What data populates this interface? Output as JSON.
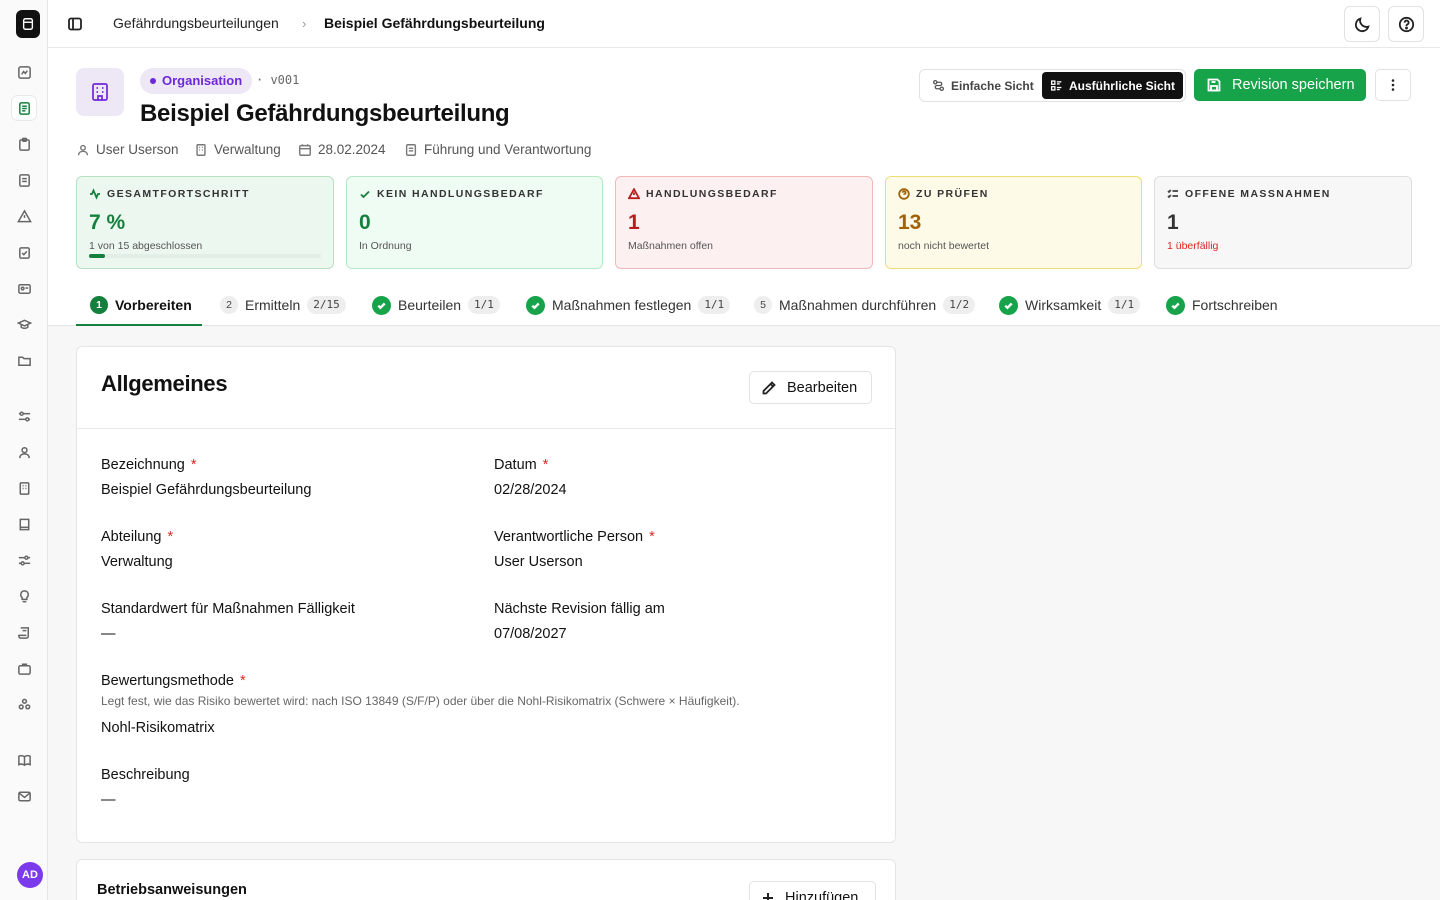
{
  "breadcrumb": {
    "parent": "Gefährdungsbeurteilungen",
    "current": "Beispiel Gefährdungsbeurteilung"
  },
  "sidebar": {
    "avatar_initials": "AD"
  },
  "header": {
    "badge": "Organisation",
    "version": "· v001",
    "title": "Beispiel Gefährdungsbeurteilung",
    "meta": {
      "user": "User Userson",
      "department": "Verwaltung",
      "date": "28.02.2024",
      "category": "Führung und Verantwortung"
    },
    "view_simple": "Einfache Sicht",
    "view_detail": "Ausführliche Sicht",
    "save_label": "Revision speichern"
  },
  "stats": [
    {
      "label": "GESAMTFORTSCHRITT",
      "value": "7 %",
      "sub": "1 von 15 abgeschlossen",
      "progress": 0.07,
      "color": "#15803d"
    },
    {
      "label": "KEIN HANDLUNGSBEDARF",
      "value": "0",
      "sub": "In Ordnung",
      "color": "#15803d"
    },
    {
      "label": "HANDLUNGSBEDARF",
      "value": "1",
      "sub": "Maßnahmen offen",
      "color": "#b91c1c"
    },
    {
      "label": "ZU PRÜFEN",
      "value": "13",
      "sub": "noch nicht bewertet",
      "color": "#a16207"
    },
    {
      "label": "OFFENE MASSNAHMEN",
      "value": "1",
      "sub": "1 überfällig",
      "color": "#333333",
      "sub_color": "#dc2626"
    }
  ],
  "tabs": [
    {
      "num": "1",
      "label": "Vorbereiten",
      "count": "",
      "status": "active"
    },
    {
      "num": "2",
      "label": "Ermitteln",
      "count": "2/15",
      "status": "open"
    },
    {
      "num": "",
      "label": "Beurteilen",
      "count": "1/1",
      "status": "done"
    },
    {
      "num": "",
      "label": "Maßnahmen festlegen",
      "count": "1/1",
      "status": "done"
    },
    {
      "num": "5",
      "label": "Maßnahmen durchführen",
      "count": "1/2",
      "status": "open"
    },
    {
      "num": "",
      "label": "Wirksamkeit",
      "count": "1/1",
      "status": "done"
    },
    {
      "num": "",
      "label": "Fortschreiben",
      "count": "",
      "status": "done"
    }
  ],
  "general": {
    "title": "Allgemeines",
    "edit_label": "Bearbeiten",
    "fields": {
      "name": {
        "label": "Bezeichnung",
        "value": "Beispiel Gefährdungsbeurteilung"
      },
      "date": {
        "label": "Datum",
        "value": "02/28/2024"
      },
      "department": {
        "label": "Abteilung",
        "value": "Verwaltung"
      },
      "responsible": {
        "label": "Verantwortliche Person",
        "value": "User Userson"
      },
      "default_due": {
        "label": "Standardwert für Maßnahmen Fälligkeit",
        "value": "—"
      },
      "next_revision": {
        "label": "Nächste Revision fällig am",
        "value": "07/08/2027"
      },
      "method": {
        "label": "Bewertungsmethode",
        "hint": "Legt fest, wie das Risiko bewertet wird: nach ISO 13849 (S/F/P) oder über die Nohl-Risikomatrix (Schwere × Häufigkeit).",
        "value": "Nohl-Risikomatrix"
      },
      "description": {
        "label": "Beschreibung",
        "value": "—"
      }
    },
    "required_mark": "*"
  },
  "instructions": {
    "title": "Betriebsanweisungen",
    "add_label": "Hinzufügen"
  }
}
